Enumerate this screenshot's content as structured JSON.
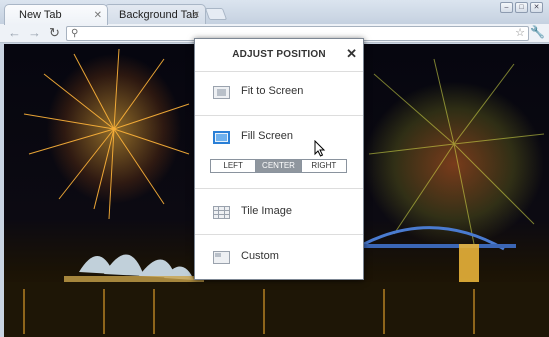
{
  "tabs": [
    {
      "label": "New Tab",
      "active": true
    },
    {
      "label": "Background Tab",
      "active": false
    }
  ],
  "window_controls": {
    "minimize": "–",
    "maximize": "□",
    "close": "✕"
  },
  "toolbar": {
    "back_icon": "←",
    "forward_icon": "→",
    "reload_icon": "↻",
    "search_icon": "⚲",
    "address_value": "",
    "star_icon": "☆",
    "wrench_icon": "🔧"
  },
  "popup": {
    "title": "ADJUST POSITION",
    "close": "✕",
    "options": {
      "fit": "Fit to Screen",
      "fill": "Fill Screen",
      "tile": "Tile Image",
      "custom": "Custom"
    },
    "positions": [
      "LEFT",
      "CENTER",
      "RIGHT"
    ],
    "selected_position": "CENTER",
    "accent_color": "#2a7fd6"
  }
}
